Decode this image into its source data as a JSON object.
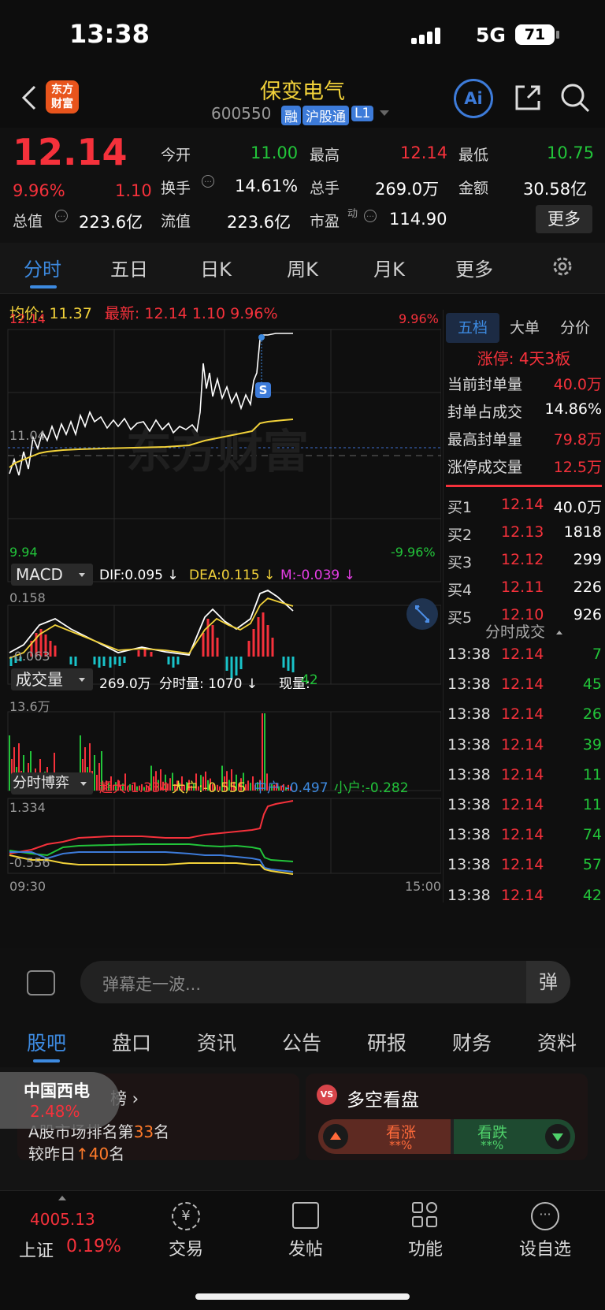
{
  "status": {
    "time": "13:38",
    "network": "5G",
    "battery": "71"
  },
  "header": {
    "title": "保变电气",
    "code": "600550",
    "badge_rong": "融",
    "badge_hgt": "沪股通",
    "badge_l1": "L1",
    "logo_line1": "东方",
    "logo_line2": "财富",
    "ai_label": "Ai"
  },
  "quote": {
    "price": "12.14",
    "pct": "9.96%",
    "chg": "1.10",
    "open_label": "今开",
    "open": "11.00",
    "high_label": "最高",
    "high": "12.14",
    "low_label": "最低",
    "low": "10.75",
    "turnover_label": "换手",
    "turnover": "14.61%",
    "volume_label": "总手",
    "volume": "269.0万",
    "amount_label": "金额",
    "amount": "30.58亿",
    "mcap_label": "总值",
    "mcap": "223.6亿",
    "float_label": "流值",
    "float": "223.6亿",
    "pe_label": "市盈",
    "pe_sup": "动",
    "pe": "114.90",
    "more": "更多"
  },
  "tabs": [
    "分时",
    "五日",
    "日K",
    "周K",
    "月K",
    "更多"
  ],
  "chart_info": {
    "avg_label": "均价:",
    "avg": "11.37",
    "latest_label": "最新:",
    "latest": "12.14",
    "chg": "1.10",
    "pct": "9.96%"
  },
  "price_chart": {
    "top_left": "12.14",
    "top_right": "9.96%",
    "mid_left": "11.04",
    "bottom_left": "9.94",
    "bottom_right": "-9.96%",
    "s_marker": "S",
    "watermark": "东方财富"
  },
  "right_tabs": [
    "五档",
    "大单",
    "分价"
  ],
  "limit": {
    "title": "涨停: 4天3板",
    "rows": [
      {
        "label": "当前封单量",
        "value": "40.0万"
      },
      {
        "label": "封单占成交",
        "value": "14.86%"
      },
      {
        "label": "最高封单量",
        "value": "79.8万"
      },
      {
        "label": "涨停成交量",
        "value": "12.5万"
      }
    ]
  },
  "orderbook": [
    {
      "label": "买1",
      "price": "12.14",
      "vol": "40.0万"
    },
    {
      "label": "买2",
      "price": "12.13",
      "vol": "1818"
    },
    {
      "label": "买3",
      "price": "12.12",
      "vol": "299"
    },
    {
      "label": "买4",
      "price": "12.11",
      "vol": "226"
    },
    {
      "label": "买5",
      "price": "12.10",
      "vol": "926"
    }
  ],
  "trades_title": "分时成交",
  "trades": [
    {
      "time": "13:38",
      "price": "12.14",
      "vol": "7"
    },
    {
      "time": "13:38",
      "price": "12.14",
      "vol": "45"
    },
    {
      "time": "13:38",
      "price": "12.14",
      "vol": "26"
    },
    {
      "time": "13:38",
      "price": "12.14",
      "vol": "39"
    },
    {
      "time": "13:38",
      "price": "12.14",
      "vol": "11"
    },
    {
      "time": "13:38",
      "price": "12.14",
      "vol": "11"
    },
    {
      "time": "13:38",
      "price": "12.14",
      "vol": "74"
    },
    {
      "time": "13:38",
      "price": "12.14",
      "vol": "57"
    },
    {
      "time": "13:38",
      "price": "12.14",
      "vol": "42"
    }
  ],
  "macd": {
    "name": "MACD",
    "dif": "DIF:0.095 ↓",
    "dea": "DEA:0.115 ↓",
    "m": "M:-0.039 ↓",
    "top": "0.158",
    "bottom": "-0.063"
  },
  "volume": {
    "name": "成交量",
    "total": "269.0万",
    "minute": "分时量: 1070 ↓",
    "now_label": "现量:",
    "now": "42",
    "top": "13.6万"
  },
  "flow": {
    "name": "分时博弈",
    "super": "超大:1.334",
    "big": "大户:-0.555",
    "mid": "中户:-0.497",
    "small": "小户:-0.282",
    "top": "1.334",
    "bottom": "-0.556"
  },
  "time_axis": {
    "start": "09:30",
    "end": "15:00"
  },
  "danmu_placeholder": "弹幕走一波...",
  "danmu_btn": "弹",
  "bottom_tabs": [
    "股吧",
    "盘口",
    "资讯",
    "公告",
    "研报",
    "财务",
    "资料"
  ],
  "cards": {
    "floating_name": "中国西电",
    "floating_pct": "2.48%",
    "rank_title": "榜",
    "rank_line1_pre": "A股市场排名第",
    "rank_line1_num": "33",
    "rank_line1_post": "名",
    "rank_line2_pre": "较昨日",
    "rank_line2_num": "40",
    "rank_line2_post": "名",
    "vs_title": "多空看盘",
    "vs_badge": "VS",
    "up_label": "看涨",
    "up_val": "**%",
    "down_label": "看跌",
    "down_val": "**%"
  },
  "nav": {
    "index_value": "4005.13",
    "index_name": "上证",
    "index_pct": "0.19%",
    "items": [
      "交易",
      "发帖",
      "功能",
      "设自选"
    ]
  },
  "colors": {
    "up": "#f5313b",
    "down": "#22c43a",
    "accent": "#3d7bd9",
    "avg": "#f2d23a"
  }
}
